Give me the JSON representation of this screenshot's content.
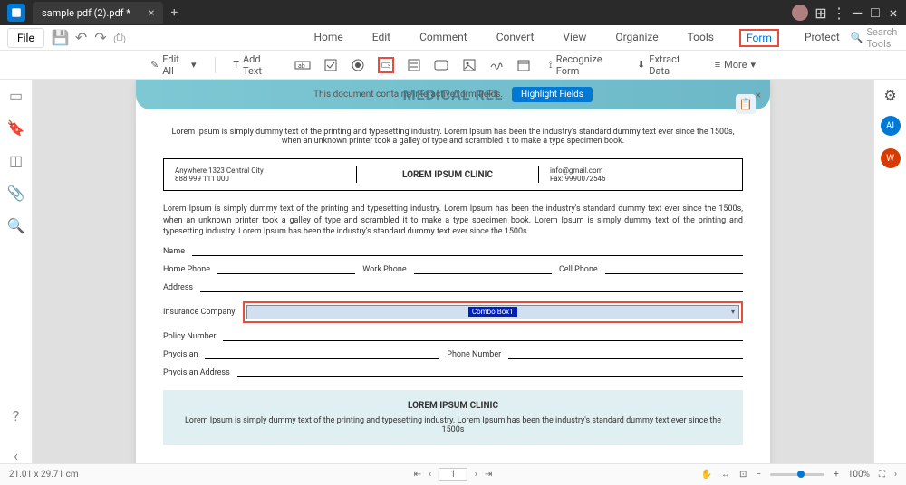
{
  "titlebar": {
    "filename": "sample pdf (2).pdf *"
  },
  "menubar": {
    "file": "File",
    "items": [
      "Home",
      "Edit",
      "Comment",
      "Convert",
      "View",
      "Organize",
      "Tools",
      "Form",
      "Protect"
    ],
    "search_placeholder": "Search Tools"
  },
  "toolbar": {
    "edit_all": "Edit All",
    "add_text": "Add Text",
    "recognize": "Recognize Form",
    "extract": "Extract Data",
    "more": "More"
  },
  "info_bar": {
    "text": "This document contains interactive form fields.",
    "watermark": "MEDICAL REL",
    "button": "Highlight Fields"
  },
  "doc": {
    "intro": "Lorem Ipsum is simply dummy text of the printing and typesetting industry. Lorem Ipsum has been the industry's standard dummy text ever since the 1500s, when an unknown printer took a galley of type and scrambled it to make a type specimen book.",
    "addr1": "Anywhere 1323 Central City",
    "addr2": "888 999 111 000",
    "clinic": "LOREM IPSUM CLINIC",
    "email": "info@gmail.com",
    "fax": "Fax: 9990072546",
    "para": "Lorem Ipsum is simply dummy text of the printing and typesetting industry. Lorem Ipsum has been the industry's standard dummy text ever since the 1500s, when an unknown printer took a galley of type and scrambled it to make a type specimen book. Lorem Ipsum is simply dummy text of the printing and typesetting industry. Lorem Ipsum has been the industry's standard dummy text ever since the 1500s",
    "labels": {
      "name": "Name",
      "home_phone": "Home Phone",
      "work_phone": "Work Phone",
      "cell_phone": "Cell Phone",
      "address": "Address",
      "insurance": "Insurance Company",
      "policy": "Policy Number",
      "physician": "Phycisian",
      "phone_number": "Phone Number",
      "physician_addr": "Phycisian Address"
    },
    "combo": "Combo Box1",
    "footer_title": "LOREM IPSUM CLINIC",
    "footer_text": "Lorem Ipsum is simply dummy text of the printing and typesetting industry. Lorem Ipsum has been the industry's standard dummy text ever since the 1500s"
  },
  "statusbar": {
    "dims": "21.01 x 29.71 cm",
    "page": "1",
    "zoom": "100%"
  }
}
